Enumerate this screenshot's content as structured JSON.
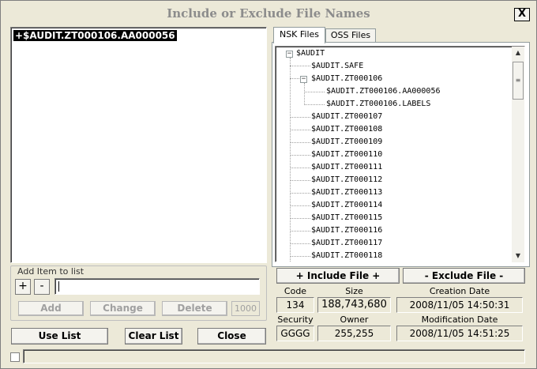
{
  "window": {
    "title": "Include or Exclude File Names",
    "close_label": "X"
  },
  "left": {
    "list_items": [
      "+$AUDIT.ZT000106.AA000056"
    ],
    "add_group_label": "Add Item to list",
    "plus_label": "+",
    "minus_label": "-",
    "item_input_value": "",
    "add_label": "Add",
    "change_label": "Change",
    "delete_label": "Delete",
    "limit_value": "1000",
    "use_list_label": "Use List",
    "clear_list_label": "Clear List",
    "close_label": "Close"
  },
  "tabs": {
    "nsk": "NSK Files",
    "oss": "OSS Files"
  },
  "tree": {
    "root": "$AUDIT",
    "safe": "$AUDIT.SAFE",
    "zt106": "$AUDIT.ZT000106",
    "zt106_aa": "$AUDIT.ZT000106.AA000056",
    "zt106_labels": "$AUDIT.ZT000106.LABELS",
    "items": [
      "$AUDIT.ZT000107",
      "$AUDIT.ZT000108",
      "$AUDIT.ZT000109",
      "$AUDIT.ZT000110",
      "$AUDIT.ZT000111",
      "$AUDIT.ZT000112",
      "$AUDIT.ZT000113",
      "$AUDIT.ZT000114",
      "$AUDIT.ZT000115",
      "$AUDIT.ZT000116",
      "$AUDIT.ZT000117",
      "$AUDIT.ZT000118"
    ]
  },
  "actions": {
    "include": "+ Include File +",
    "exclude": "- Exclude File -"
  },
  "details": {
    "code_label": "Code",
    "code": "134",
    "size_label": "Size",
    "size": "188,743,680",
    "created_label": "Creation Date",
    "created": "2008/11/05 14:50:31",
    "security_label": "Security",
    "security": "GGGG",
    "owner_label": "Owner",
    "owner": "255,255",
    "modified_label": "Modification Date",
    "modified": "2008/11/05 14:51:25"
  },
  "status": {
    "text": ""
  }
}
